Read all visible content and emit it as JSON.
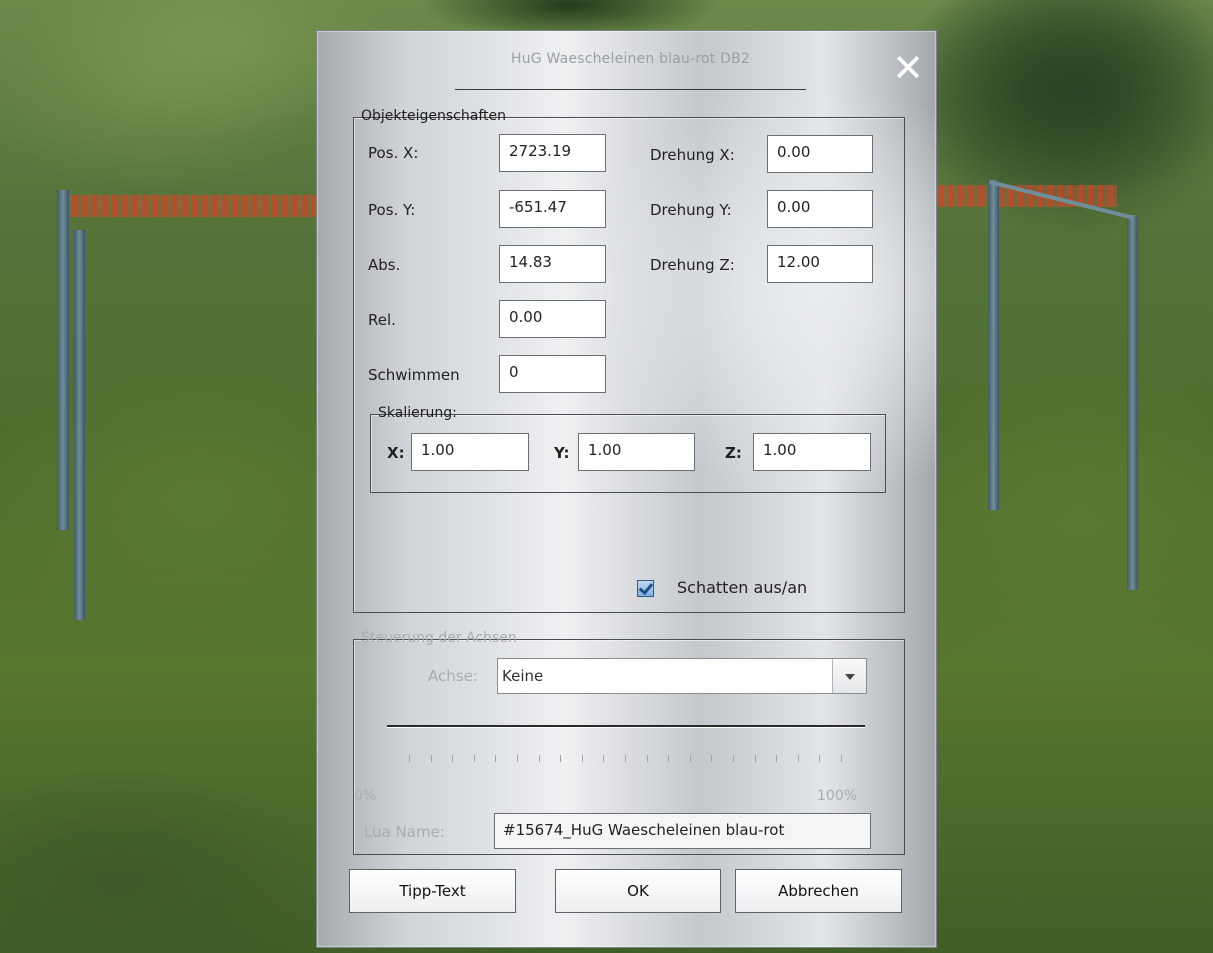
{
  "dialog": {
    "title": "HuG Waescheleinen blau-rot DB2",
    "close_icon": "close-icon",
    "object_properties": {
      "legend": "Objekteigenschaften",
      "pos_x_label": "Pos. X:",
      "pos_x_value": "2723.19",
      "pos_y_label": "Pos. Y:",
      "pos_y_value": "-651.47",
      "abs_label": "Abs.",
      "abs_value": "14.83",
      "rel_label": "Rel.",
      "rel_value": "0.00",
      "swim_label": "Schwimmen",
      "swim_value": "0",
      "rot_x_label": "Drehung X:",
      "rot_x_value": "0.00",
      "rot_y_label": "Drehung Y:",
      "rot_y_value": "0.00",
      "rot_z_label": "Drehung Z:",
      "rot_z_value": "12.00",
      "shadow_label": "Schatten aus/an",
      "shadow_checked": true
    },
    "scaling": {
      "legend": "Skalierung:",
      "x_label": "X:",
      "x_value": "1.00",
      "y_label": "Y:",
      "y_value": "1.00",
      "z_label": "Z:",
      "z_value": "1.00"
    },
    "axis_control": {
      "legend": "Steuerung der Achsen",
      "axis_label": "Achse:",
      "axis_value": "Keine",
      "slider_min_label": "0%",
      "slider_max_label": "100%",
      "slider_value": 0,
      "lua_label": "Lua Name:",
      "lua_value": "#15674_HuG Waescheleinen blau-rot"
    },
    "buttons": {
      "tip_text": "Tipp-Text",
      "ok": "OK",
      "cancel": "Abbrechen"
    }
  },
  "colors": {
    "dialog_metal_light": "#eef0f2",
    "dialog_metal_dark": "#a6aaae",
    "disabled_text": "#a9adb1",
    "grass": "#56743a"
  }
}
